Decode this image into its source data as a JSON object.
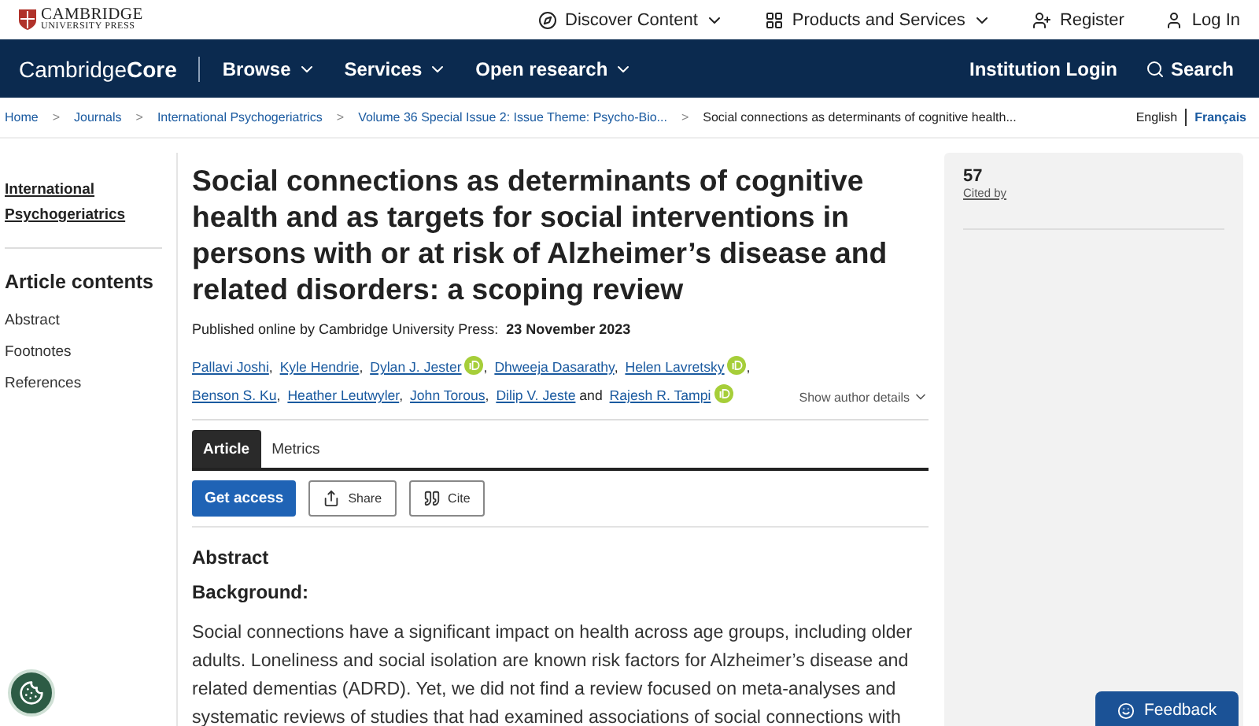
{
  "publisher_bar": {
    "logo_line_1": "CAMBRIDGE",
    "logo_line_2": "UNIVERSITY PRESS",
    "links": [
      {
        "label": "Discover Content",
        "caret": true
      },
      {
        "label": "Products and Services",
        "caret": true
      },
      {
        "label": "Register",
        "caret": false
      },
      {
        "label": "Log In",
        "caret": false
      }
    ]
  },
  "nav_bar": {
    "brand_light": "Cambridge",
    "brand_bold": "Core",
    "menus": [
      "Browse",
      "Services",
      "Open research"
    ],
    "institution_login": "Institution Login",
    "search": "Search"
  },
  "breadcrumb_separator": ">",
  "breadcrumbs": [
    {
      "label": "Home",
      "current": false
    },
    {
      "label": "Journals",
      "current": false
    },
    {
      "label": "International Psychogeriatrics",
      "current": false
    },
    {
      "label": "Volume 36 Special Issue 2: Issue Theme: Psycho-Bio...",
      "current": false
    },
    {
      "label": "Social connections as determinants of cognitive health...",
      "current": true
    }
  ],
  "languages": [
    {
      "label": "English",
      "selected": false
    },
    {
      "label": "Français",
      "selected": true
    }
  ],
  "sidebar": {
    "journal": "International Psychogeriatrics",
    "contents_title": "Article contents",
    "items": [
      "Abstract",
      "Footnotes",
      "References"
    ]
  },
  "article": {
    "title": "Social connections as determinants of cognitive health and as targets for social interventions in persons with or at risk of Alzheimer’s disease and related disorders: a scoping review",
    "published_label": "Published online by Cambridge University Press:",
    "published_date": "23 November 2023",
    "authors": [
      {
        "name": "Pallavi Joshi",
        "orcid": false,
        "after": ","
      },
      {
        "name": "Kyle Hendrie",
        "orcid": false,
        "after": ","
      },
      {
        "name": "Dylan J. Jester",
        "orcid": true,
        "after": ","
      },
      {
        "name": "Dhweeja Dasarathy",
        "orcid": false,
        "after": ","
      },
      {
        "name": "Helen Lavretsky",
        "orcid": true,
        "after": ","
      },
      {
        "name": "Benson S. Ku",
        "orcid": false,
        "after": ","
      },
      {
        "name": "Heather Leutwyler",
        "orcid": false,
        "after": ","
      },
      {
        "name": "John Torous",
        "orcid": false,
        "after": ","
      },
      {
        "name": "Dilip V. Jeste",
        "orcid": false,
        "after": "and"
      },
      {
        "name": "Rajesh R. Tampi",
        "orcid": true
      }
    ],
    "show_author_details": "Show author details",
    "tabs": [
      {
        "label": "Article",
        "selected": true
      },
      {
        "label": "Metrics",
        "selected": false
      }
    ],
    "actions": [
      {
        "label": "Get access",
        "kind": "primary"
      },
      {
        "label": "Share",
        "kind": "share"
      },
      {
        "label": "Cite",
        "kind": "cite"
      }
    ],
    "abstract_heading": "Abstract",
    "section_heading": "Background:",
    "paragraph": "Social connections have a significant impact on health across age groups, including older adults. Loneliness and social isolation are known risk factors for Alzheimer’s disease and related dementias (ADRD). Yet, we did not find a review focused on meta-analyses and systematic reviews of studies that had examined associations of social connections with"
  },
  "metrics_panel": {
    "count": "57",
    "label": "Cited by"
  },
  "feedback": "Feedback"
}
